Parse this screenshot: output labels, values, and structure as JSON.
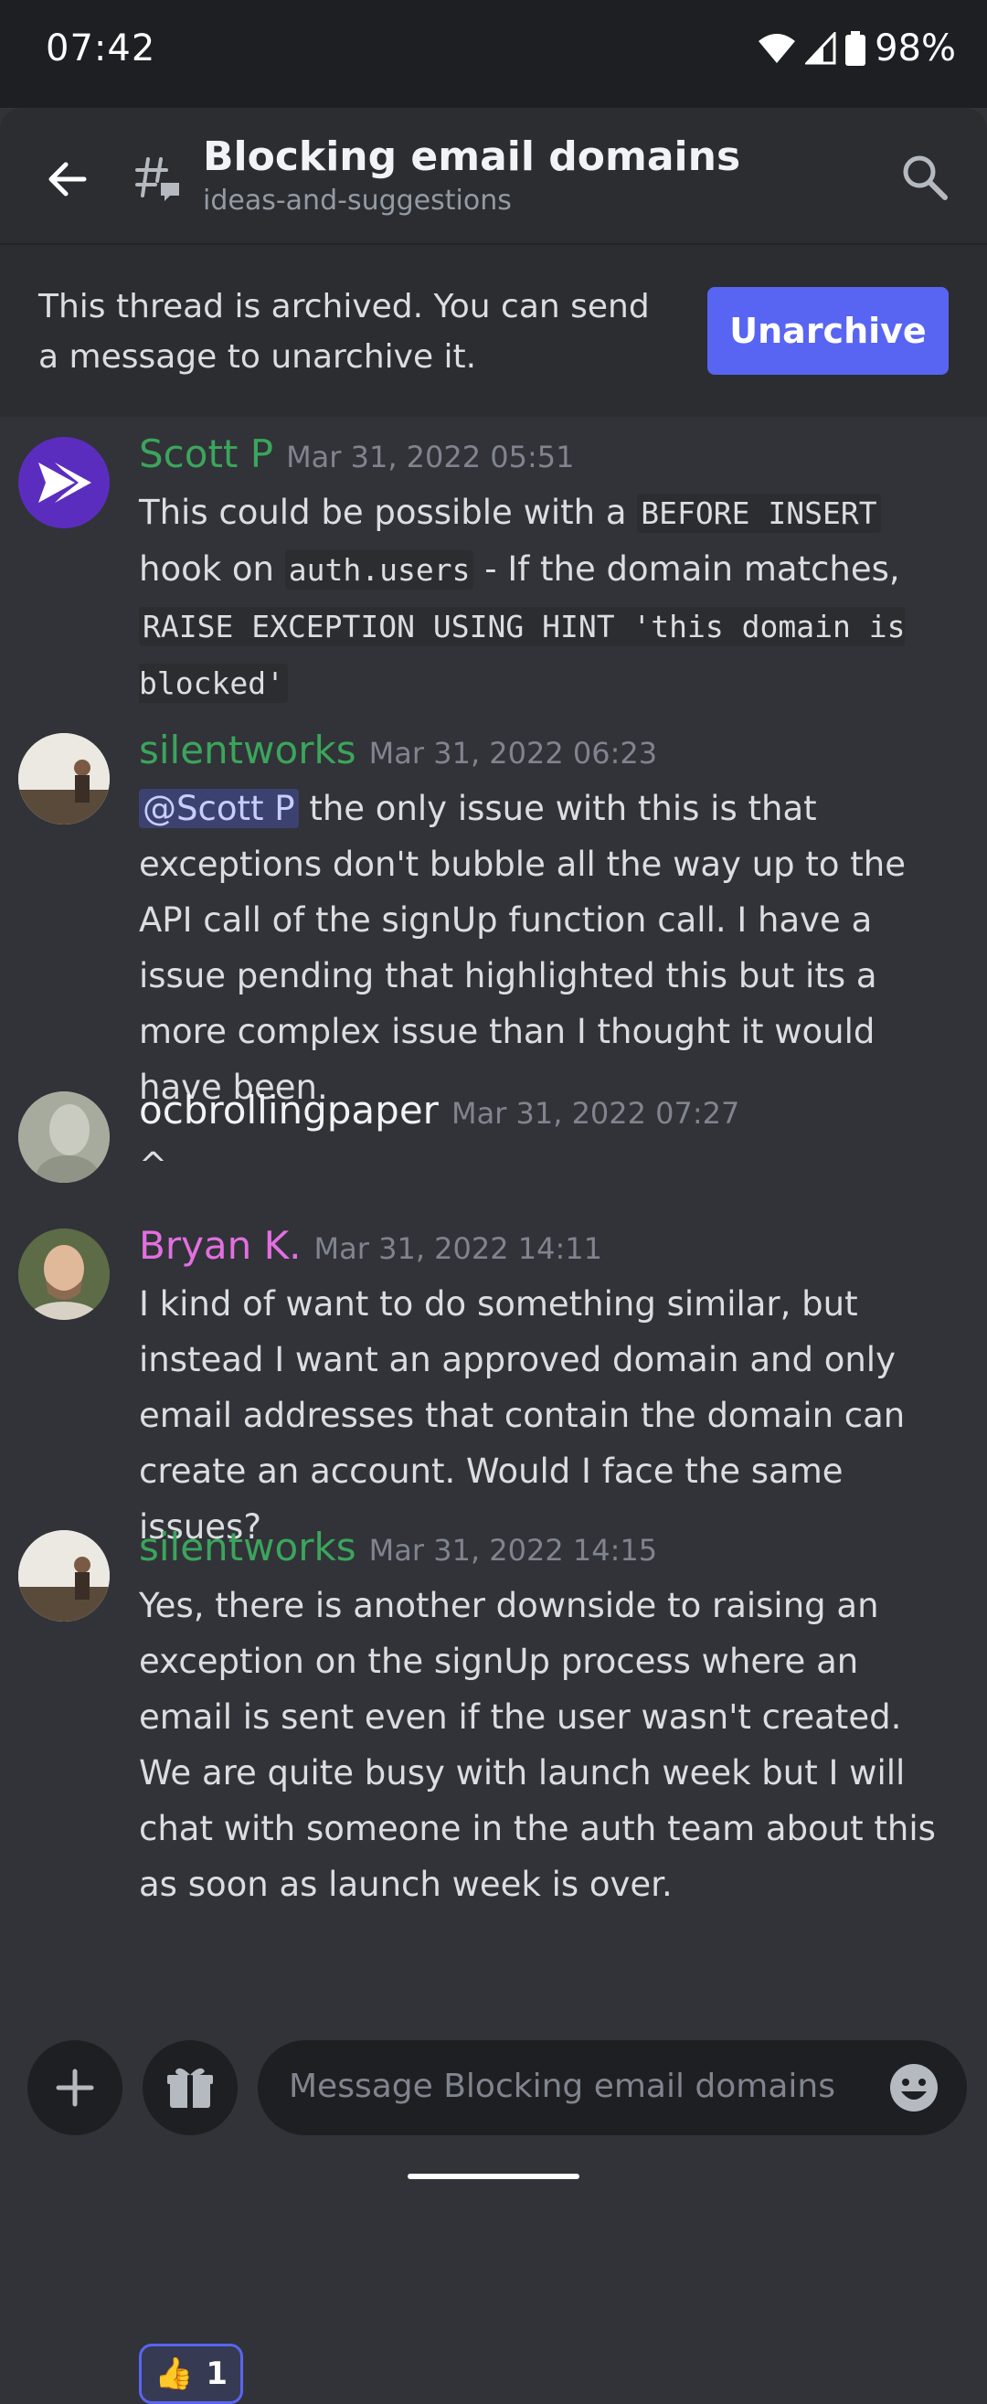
{
  "status_bar": {
    "time": "07:42",
    "battery": "98%"
  },
  "header": {
    "title": "Blocking email domains",
    "channel": "ideas-and-suggestions"
  },
  "archive_banner": {
    "text": "This thread is archived. You can send a message to unarchive it.",
    "button_label": "Unarchive"
  },
  "messages": [
    {
      "author": "Scott P",
      "author_color": "#3ba55c",
      "timestamp": "Mar 31, 2022 05:51",
      "parts": {
        "t1": "This could be possible with a ",
        "c1": "BEFORE INSERT",
        "t2": " hook on ",
        "c2": "auth.users",
        "t3": " - If the domain matches, ",
        "c3": "RAISE EXCEPTION USING HINT 'this domain is blocked'"
      }
    },
    {
      "author": "silentworks",
      "author_color": "#3ba55c",
      "timestamp": "Mar 31, 2022 06:23",
      "mention": "@Scott P",
      "text": " the only issue with this is that exceptions don't bubble all the way up to the API call of the signUp function call. I have a issue pending that highlighted this but its a more complex issue than I thought it would have been."
    },
    {
      "author": "ocbrollingpaper",
      "author_color": "#f2f3f5",
      "timestamp": "Mar 31, 2022 07:27",
      "text": "^"
    },
    {
      "author": "Bryan K.",
      "author_color": "#e26fe0",
      "timestamp": "Mar 31, 2022 14:11",
      "text": "I kind of want to do something similar, but instead I want an approved domain and only email addresses that contain the domain can create an account.  Would I face the same issues?"
    },
    {
      "author": "silentworks",
      "author_color": "#3ba55c",
      "timestamp": "Mar 31, 2022 14:15",
      "text": "Yes, there is another downside to raising an exception on the signUp process where an email is sent even if the user wasn't created. We are quite busy with launch week but I will chat with someone in the auth team about this as soon as launch week is over.",
      "reaction": {
        "emoji": "👍",
        "count": "1"
      }
    }
  ],
  "composer": {
    "placeholder": "Message Blocking email domains"
  },
  "icons": [
    "back-arrow-icon",
    "thread-icon",
    "search-icon",
    "plus-icon",
    "gift-icon",
    "emoji-icon",
    "wifi-icon",
    "signal-icon",
    "battery-icon"
  ]
}
